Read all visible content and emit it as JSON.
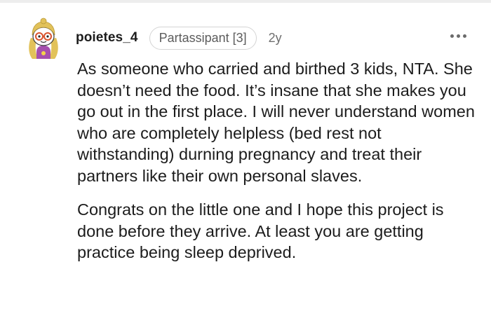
{
  "comment": {
    "avatar_icon": "snoo-avatar-glasses-icon",
    "username": "poietes_4",
    "flair": "Partassipant [3]",
    "age": "2y",
    "more_icon": "more-options-icon",
    "paragraphs": [
      "As someone who carried and birthed 3 kids, NTA. She doesn’t need the food. It’s insane that she makes you go out in the first place. I will never understand women who are completely helpless (bed rest not withstanding) durning pregnancy and treat their partners like their own personal slaves.",
      "Congrats on the little one and I hope this project is done before they arrive. At least you are getting practice being sleep deprived."
    ]
  },
  "colors": {
    "text": "#1c1c1c",
    "meta": "#6f6f6f",
    "flair_border": "#d4d4d4",
    "avatar_hair": "#e2c25a",
    "avatar_glasses": "#d9542e"
  }
}
